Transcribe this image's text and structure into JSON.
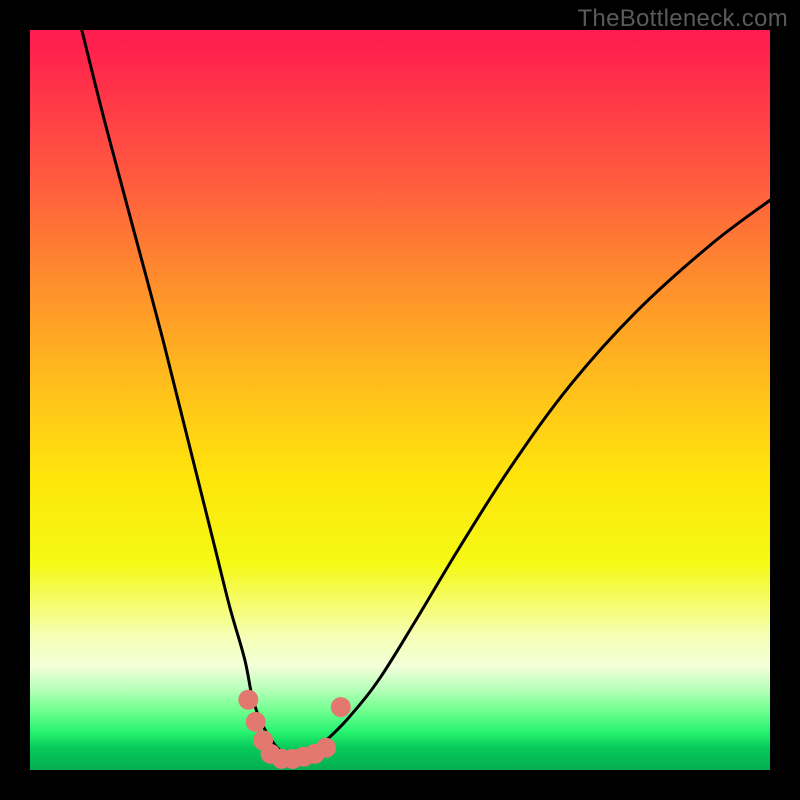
{
  "attribution": "TheBottleneck.com",
  "colors": {
    "frame": "#000000",
    "curve": "#000000",
    "dot": "#e2786f",
    "grad_stops": [
      "#ff1a4f",
      "#ff3348",
      "#ff5a3f",
      "#ff8a2e",
      "#ffb81e",
      "#ffe40c",
      "#f5f914",
      "#f6ffb6",
      "#f2ffd9",
      "#b8ffba",
      "#6fff8f",
      "#24f26e",
      "#08c95b",
      "#04ae51"
    ]
  },
  "chart_data": {
    "type": "line",
    "title": "",
    "xlabel": "",
    "ylabel": "",
    "xlim": [
      0,
      100
    ],
    "ylim": [
      0,
      100
    ],
    "note": "Values are percentages of plot width/height. y=0 is bottom (green), y=100 is top (red). Two curves forming a V; dots cluster at the valley bottom.",
    "series": [
      {
        "name": "left_curve",
        "x": [
          7,
          10,
          14,
          18,
          22,
          25,
          27,
          29,
          30,
          31,
          32,
          33,
          34,
          36
        ],
        "y": [
          100,
          88,
          73,
          58,
          42,
          30,
          22,
          15,
          10,
          7,
          5,
          3.5,
          2.5,
          1.5
        ]
      },
      {
        "name": "right_curve",
        "x": [
          36,
          38,
          40,
          43,
          47,
          52,
          58,
          65,
          73,
          82,
          92,
          100
        ],
        "y": [
          1.5,
          2.5,
          4,
          7,
          12,
          20,
          30,
          41,
          52,
          62,
          71,
          77
        ]
      }
    ],
    "dots": {
      "name": "valley_points",
      "x": [
        29.5,
        30.5,
        31.5,
        32.5,
        34.0,
        35.5,
        37.0,
        38.5,
        40.0,
        42.0
      ],
      "y": [
        9.5,
        6.5,
        4.0,
        2.2,
        1.5,
        1.5,
        1.8,
        2.2,
        3.0,
        8.5
      ]
    }
  }
}
